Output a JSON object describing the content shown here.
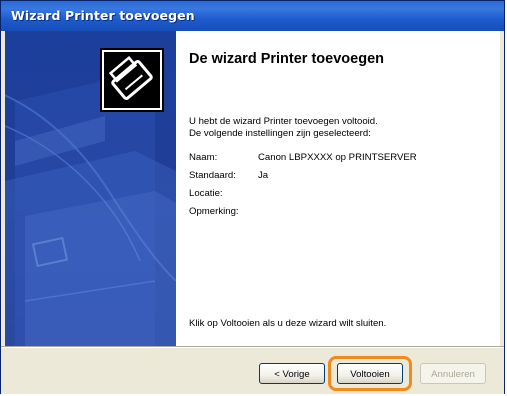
{
  "window": {
    "title": "Wizard Printer toevoegen"
  },
  "main": {
    "heading": "De wizard Printer toevoegen",
    "intro_line1": "U hebt de wizard Printer toevoegen voltooid.",
    "intro_line2": "De volgende instellingen zijn geselecteerd:",
    "settings": [
      {
        "label": "Naam:",
        "value": "Canon LBPXXXX op PRINTSERVER"
      },
      {
        "label": "Standaard:",
        "value": "Ja"
      },
      {
        "label": "Locatie:",
        "value": ""
      },
      {
        "label": "Opmerking:",
        "value": ""
      }
    ],
    "footer_text": "Klik op Voltooien als u deze wizard wilt sluiten."
  },
  "buttons": {
    "back": "< Vorige",
    "finish": "Voltooien",
    "cancel": "Annuleren"
  },
  "colors": {
    "panel_blue": "#213e95",
    "highlight_orange": "#f28a1b",
    "titlebar_blue": "#1e5bcf"
  },
  "icons": {
    "wizard_graphic": "printer-graphic-icon",
    "printer_badge": "printer-icon"
  }
}
